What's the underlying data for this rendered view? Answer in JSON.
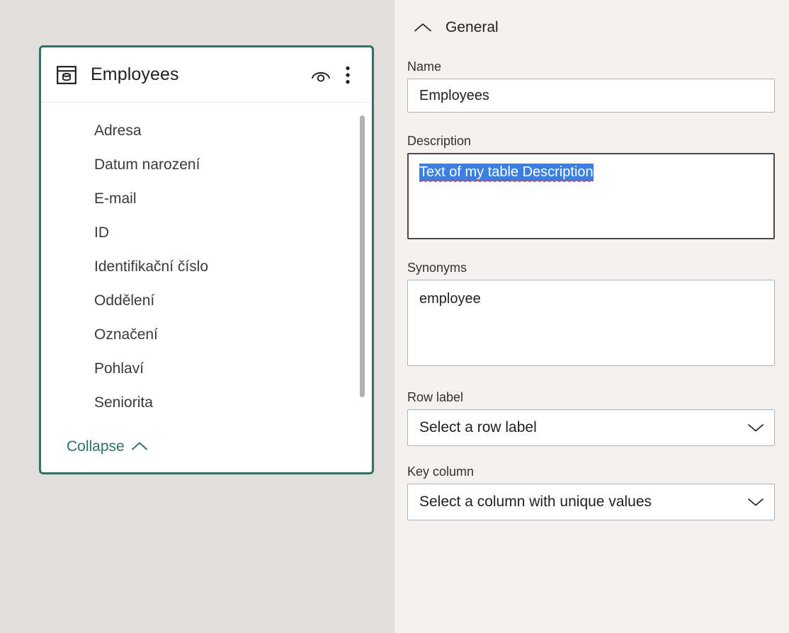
{
  "canvas": {
    "table_card": {
      "title": "Employees",
      "icon": "table-database-icon",
      "preview_icon": "preview-data-icon",
      "more_icon": "more-options-icon",
      "fields": [
        "Adresa",
        "Datum narození",
        "E-mail",
        "ID",
        "Identifikační číslo",
        "Oddělení",
        "Označení",
        "Pohlaví",
        "Seniorita"
      ],
      "collapse_label": "Collapse",
      "collapse_icon": "chevron-up-icon",
      "accent_color": "#2f7163"
    }
  },
  "panel": {
    "section": {
      "title": "General",
      "collapse_icon": "chevron-up-icon"
    },
    "name": {
      "label": "Name",
      "value": "Employees",
      "placeholder": "Name"
    },
    "description": {
      "label": "Description",
      "value": "Text of my table Description",
      "placeholder": "Description",
      "selected": true,
      "selection_color": "#3d7fe0",
      "spellcheck_color": "#e03a2f"
    },
    "synonyms": {
      "label": "Synonyms",
      "value": "employee",
      "placeholder": "Synonyms"
    },
    "row_label": {
      "label": "Row label",
      "value": "Select a row label",
      "chevron_icon": "chevron-down-icon"
    },
    "key_column": {
      "label": "Key column",
      "value": "Select a column with unique values",
      "chevron_icon": "chevron-down-icon"
    }
  }
}
